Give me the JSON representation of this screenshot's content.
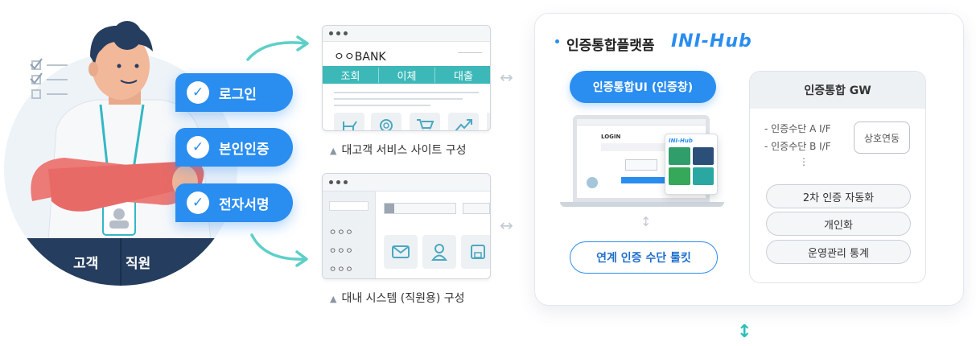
{
  "roles": {
    "customer": "고객",
    "employee": "직원"
  },
  "checks": [
    {
      "label": "로그인"
    },
    {
      "label": "본인인증"
    },
    {
      "label": "전자서명"
    }
  ],
  "bank_site": {
    "brand": "ㅇㅇBANK",
    "menu": [
      "조회",
      "이체",
      "대출"
    ],
    "caption": "대고객 서비스 사이트 구성"
  },
  "internal_system": {
    "caption": "대내 시스템 (직원용) 구성",
    "sidebar_items": [
      "ㅇㅇㅇ",
      "ㅇㅇㅇ",
      "ㅇㅇㅇ"
    ]
  },
  "platform": {
    "title": "인증통합플랫폼",
    "logo_text": "INI-Hub",
    "ui_button": "인증통합UI (인증창)",
    "toolkit_button": "연계 인증 수단 툴킷",
    "mock_login": "LOGIN",
    "mock_logo": "INI-Hub"
  },
  "gateway": {
    "title": "인증통합 GW",
    "interfaces": [
      "- 인증수단 A I/F",
      "- 인증수단 B I/F",
      "⋮"
    ],
    "interop": "상호연동",
    "features": [
      "2차 인증 자동화",
      "개인화",
      "운영관리 통계"
    ]
  },
  "colors": {
    "accent": "#2a8df0",
    "teal": "#2bbfb8",
    "menu_teal": "#3cb8b8"
  }
}
